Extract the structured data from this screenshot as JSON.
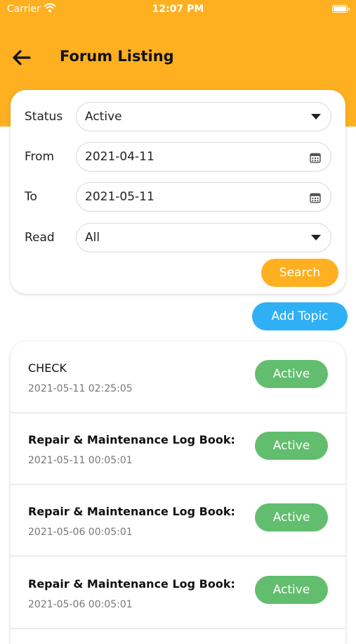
{
  "status_bar": {
    "carrier": "Carrier",
    "time": "12:07 PM"
  },
  "header": {
    "title": "Forum Listing"
  },
  "filters": {
    "status_label": "Status",
    "status_value": "Active",
    "from_label": "From",
    "from_value": "2021-04-11",
    "to_label": "To",
    "to_value": "2021-05-11",
    "read_label": "Read",
    "read_value": "All",
    "search_label": "Search"
  },
  "add_topic_label": "Add Topic",
  "topics": [
    {
      "title": "CHECK",
      "date": "2021-05-11 02:25:05",
      "status": "Active"
    },
    {
      "title": "Repair & Maintenance Log Book: ...",
      "date": "2021-05-11 00:05:01",
      "status": "Active"
    },
    {
      "title": "Repair & Maintenance Log Book: ...",
      "date": "2021-05-06 00:05:01",
      "status": "Active"
    },
    {
      "title": "Repair & Maintenance Log Book: ...",
      "date": "2021-05-06 00:05:01",
      "status": "Active"
    }
  ],
  "colors": {
    "accent": "#FFB020",
    "add_button": "#2FB0F5",
    "active_badge": "#62BE6E"
  }
}
